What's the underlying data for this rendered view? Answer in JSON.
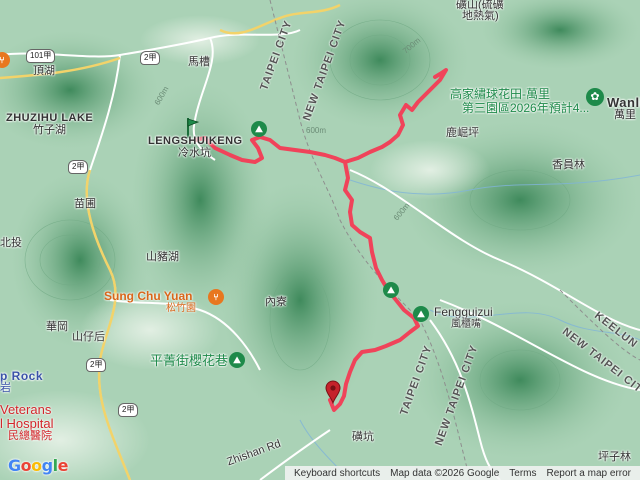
{
  "map_labels": {
    "top_right_1": "礦山(硫礦",
    "top_right_2": "地熱氣)",
    "mashao": "馬槽",
    "touhu": "頂湖",
    "zhuzihu_lake": "ZHUZIHU LAKE",
    "zhuzihu": "竹子湖",
    "lengshuikeng_en": "LENGSHUIKENG",
    "lengshuikeng_zh": "冷水坑",
    "miaopu": "苗圃",
    "beitou": "北投",
    "shanzhuhu": "山豬湖",
    "neiliao": "內寮",
    "huagang": "華岡",
    "shanzihou": "山仔后",
    "rock_partial": "p Rock",
    "yan": "岩",
    "luyuanping": "鹿崛坪",
    "xiangchanglin": "香員林",
    "wanli_en": "Wanli D",
    "wanli_zh": "萬里",
    "xiziliin": "坪子林",
    "beikeng": "磺坑",
    "zhishan_rd": "Zhishan Rd"
  },
  "city_labels": {
    "taipei_city_1": "TAIPEI CITY",
    "new_taipei_city_1": "NEW TAIPEI CITY",
    "taipei_city_2": "TAIPEI CITY",
    "new_taipei_city_2": "NEW TAIPEI CITY",
    "new_taipei_city_3": "NEW TAIPEI CITY",
    "keelung_partial": "KEELUN"
  },
  "elevations": {
    "e1": "600m",
    "e2": "600m",
    "e3": "700m",
    "e4": "600m"
  },
  "route_shields": {
    "r101a": "101甲",
    "r2a_1": "2甲",
    "r2a_2": "2甲",
    "r2a_3": "2甲",
    "r2a_4": "2甲"
  },
  "pois": {
    "gao_family_title": "高家繡球花田-萬里",
    "gao_family_sub": "第三園區2026年預計4...",
    "fengguizui_en": "Fengguizui",
    "fengguizui_zh": "風櫃嘴",
    "sung_chu_yuan_en": "Sung Chu Yuan",
    "sung_chu_yuan_zh": "松竹園",
    "pingjing_street": "平菁街櫻花巷",
    "veterans_1": "Veterans",
    "veterans_2": "l Hospital",
    "veterans_zh": "民總醫院"
  },
  "logo_text": "Google",
  "attribution": {
    "keyboard_shortcuts": "Keyboard shortcuts",
    "map_data": "Map data ©2026 Google",
    "terms": "Terms",
    "report": "Report a map error"
  },
  "colors": {
    "track": "#f0435a",
    "poi_green": "#1e8a4a",
    "poi_orange": "#e8771f",
    "start_marker": "#1e8a4a",
    "end_marker": "#c5222b"
  },
  "icons": {
    "start": "start-flag-marker-icon",
    "end": "end-pin-marker-icon",
    "hiking": "hiking-poi-icon",
    "restaurant": "restaurant-poi-icon",
    "flower": "flower-poi-icon"
  }
}
